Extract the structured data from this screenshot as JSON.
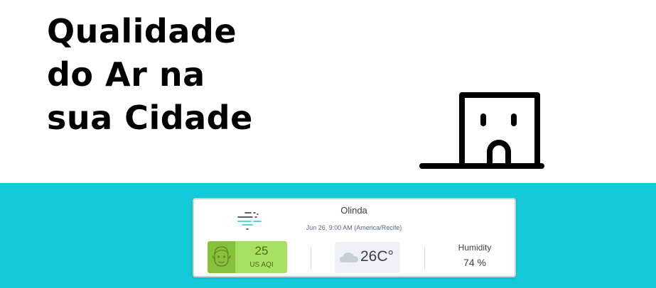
{
  "hero": {
    "title_lines": [
      "Qualidade",
      "do Ar na",
      "sua Cidade"
    ],
    "illustration_icon": "building-door-icon"
  },
  "widget": {
    "location": "Olinda",
    "timestamp": "Jun 26, 9:00 AM (America/Recife)",
    "wind_icon": "wind-icon",
    "aqi": {
      "value": "25",
      "label": "US AQI",
      "face_icon": "face-icon",
      "color": "#a8e05f",
      "face_bg_color": "#87c13c"
    },
    "weather": {
      "icon": "cloud-icon",
      "temperature": "26C°"
    },
    "humidity": {
      "label": "Humidity",
      "value": "74 %"
    }
  },
  "colors": {
    "band": "#13cad6",
    "headline": "#000000"
  }
}
